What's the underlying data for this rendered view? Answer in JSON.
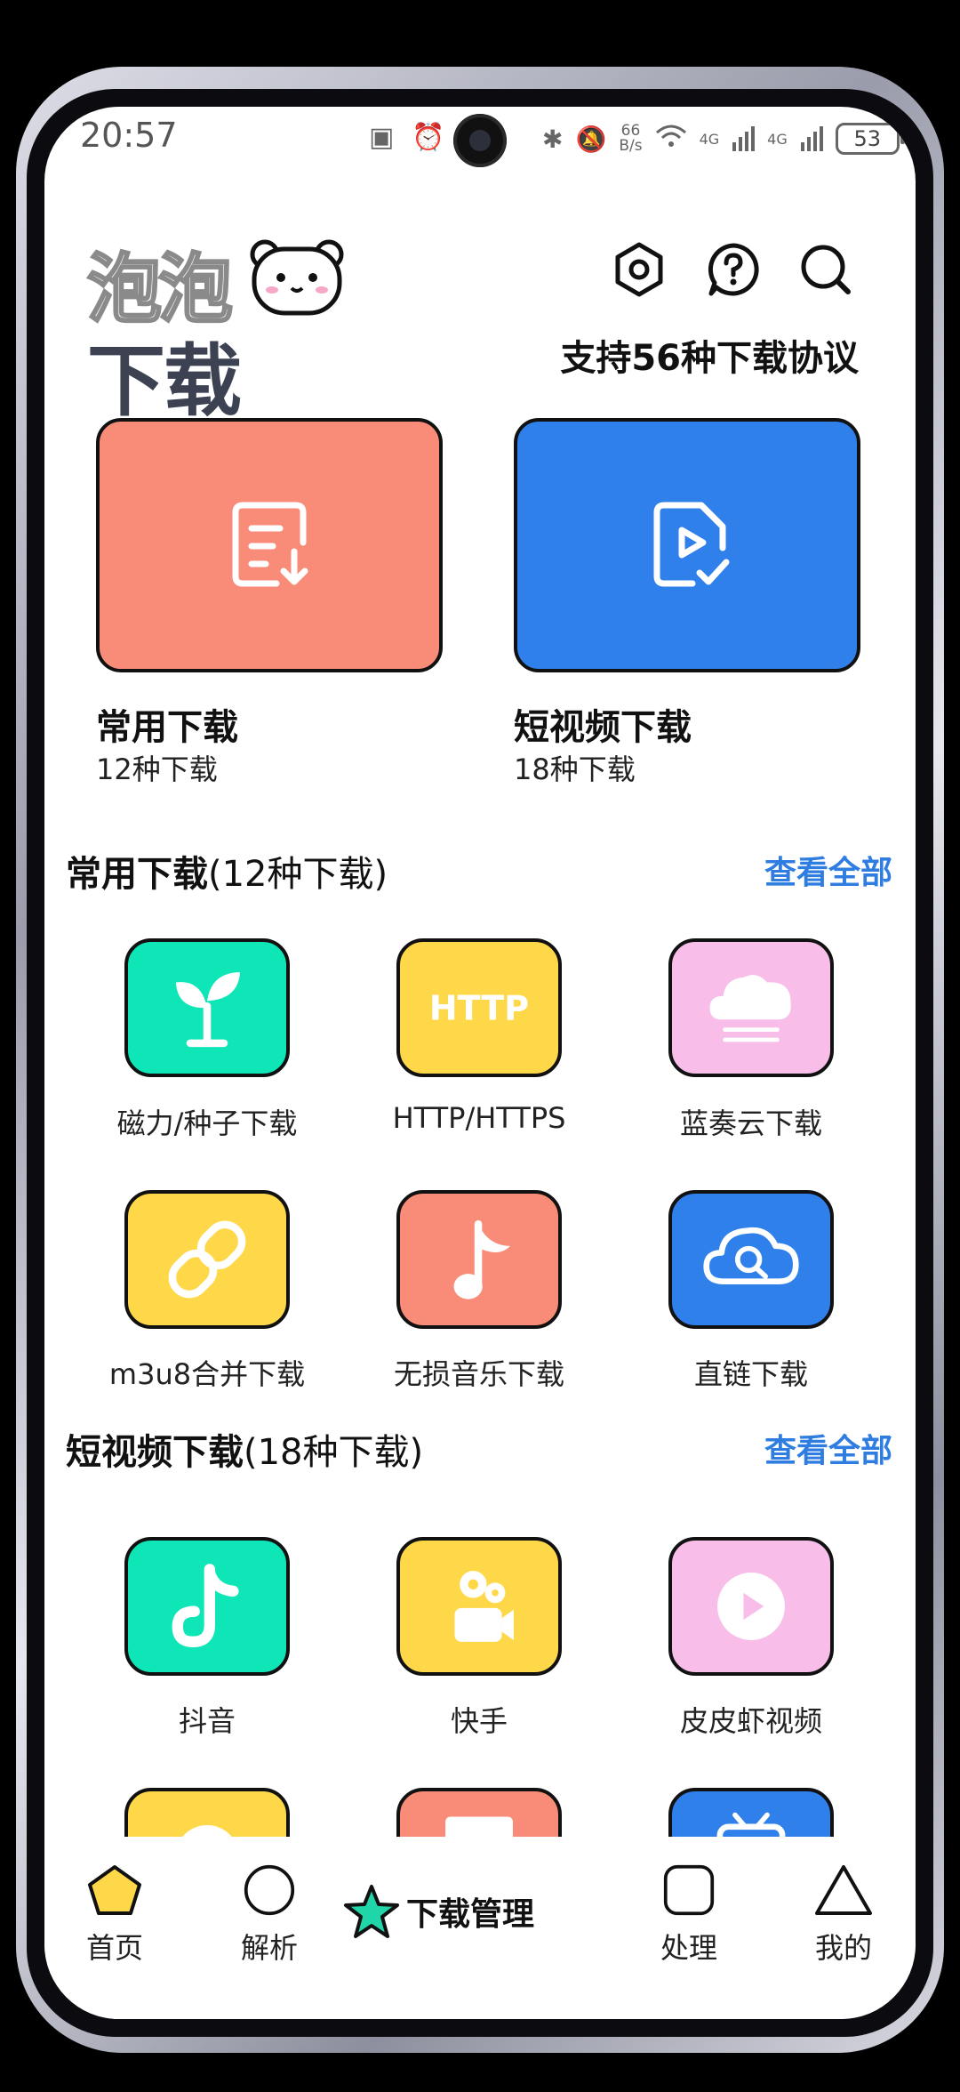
{
  "status_bar": {
    "time": "20:57",
    "net_speed_value": "66",
    "net_speed_unit": "B/s",
    "signal1": "4G",
    "signal2": "4G",
    "battery": "53"
  },
  "header": {
    "logo_top": "泡泡",
    "logo_bottom": "下载",
    "tagline": "支持56种下载协议"
  },
  "big_cards": [
    {
      "title": "常用下载",
      "subtitle": "12种下载",
      "color": "#f98c78"
    },
    {
      "title": "短视频下载",
      "subtitle": "18种下载",
      "color": "#2f80ea"
    }
  ],
  "common_section": {
    "title": "常用下载",
    "count": "(12种下载)",
    "more": "查看全部",
    "items": [
      {
        "label": "磁力/种子下载",
        "icon": "sprout-icon",
        "color": "#0ee6b8"
      },
      {
        "label": "HTTP/HTTPS",
        "icon": "http-icon",
        "color": "#ffd84a",
        "icon_text": "HTTP"
      },
      {
        "label": "蓝奏云下载",
        "icon": "cloud-icon",
        "color": "#f8bde8"
      },
      {
        "label": "m3u8合并下载",
        "icon": "link-icon",
        "color": "#ffd84a"
      },
      {
        "label": "无损音乐下载",
        "icon": "music-note-icon",
        "color": "#f98c78"
      },
      {
        "label": "直链下载",
        "icon": "cloud-search-icon",
        "color": "#2f80ea"
      }
    ]
  },
  "video_section": {
    "title": "短视频下载",
    "count": "(18种下载)",
    "more": "查看全部",
    "items": [
      {
        "label": "抖音",
        "icon": "douyin-icon",
        "color": "#0ee6b8"
      },
      {
        "label": "快手",
        "icon": "kuaishou-icon",
        "color": "#ffd84a"
      },
      {
        "label": "皮皮虾视频",
        "icon": "play-circle-icon",
        "color": "#f8bde8"
      },
      {
        "label": "",
        "icon": "partial-icon",
        "color": "#ffd84a"
      },
      {
        "label": "",
        "icon": "partial-icon",
        "color": "#f98c78"
      },
      {
        "label": "",
        "icon": "tv-icon",
        "color": "#2f80ea"
      }
    ]
  },
  "bottom_nav": {
    "home": "首页",
    "parse": "解析",
    "center": "下载管理",
    "process": "处理",
    "mine": "我的",
    "home_color": "#ffd84a",
    "center_color": "#20d6a8"
  }
}
